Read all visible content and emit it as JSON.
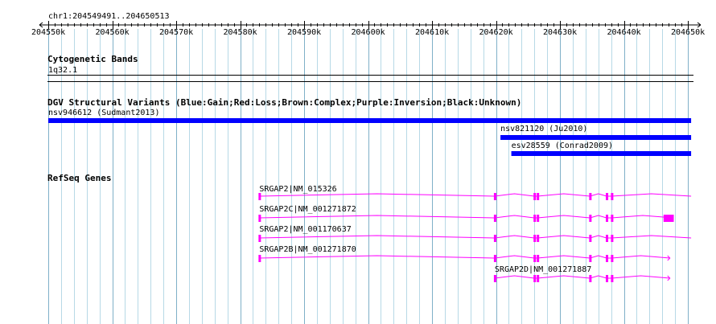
{
  "region": {
    "label": "chr1:204549491..204650513",
    "start": 204549491,
    "end": 204650513
  },
  "ruler": {
    "tick_labels": [
      "204550k",
      "204560k",
      "204570k",
      "204580k",
      "204590k",
      "204600k",
      "204610k",
      "204620k",
      "204630k",
      "204640k",
      "204650k"
    ],
    "tick_values": [
      204550000,
      204560000,
      204570000,
      204580000,
      204590000,
      204600000,
      204610000,
      204620000,
      204630000,
      204640000,
      204650000
    ]
  },
  "tracks": {
    "cytobands": {
      "title": "Cytogenetic Bands",
      "band_label": "1q32.1"
    },
    "dgv": {
      "title": "DGV Structural Variants (Blue:Gain;Red:Loss;Brown:Complex;Purple:Inversion;Black:Unknown)",
      "color": "#0000ff",
      "variants": [
        {
          "label": "nsv946612 (Sudmant2013)",
          "start": 204550000,
          "end": 204650513
        },
        {
          "label": "nsv821120 (Ju2010)",
          "start": 204620700,
          "end": 204650513
        },
        {
          "label": "esv28559 (Conrad2009)",
          "start": 204622400,
          "end": 204650513
        }
      ]
    },
    "refseq": {
      "title": "RefSeq Genes",
      "color": "#ff00ff",
      "genes": [
        {
          "label": "SRGAP2|NM_015326",
          "start": 204583000,
          "end": 204650513,
          "exons": [
            204583000,
            204619800,
            204626000,
            204626500,
            204634700,
            204637300,
            204638100
          ]
        },
        {
          "label": "SRGAP2C|NM_001271872",
          "start": 204583000,
          "end": 204647800,
          "exons": [
            204583000,
            204619800,
            204626000,
            204626500,
            204634700,
            204637300,
            204638100
          ],
          "end_block": [
            204646200,
            204647800
          ]
        },
        {
          "label": "SRGAP2|NM_001170637",
          "start": 204583000,
          "end": 204650513,
          "exons": [
            204583000,
            204619800,
            204626000,
            204626500,
            204634700,
            204637300,
            204638100
          ]
        },
        {
          "label": "SRGAP2B|NM_001271870",
          "start": 204583000,
          "end": 204647200,
          "exons": [
            204583000,
            204619800,
            204626000,
            204626500,
            204634700,
            204637300,
            204638100
          ]
        },
        {
          "label": "SRGAP2D|NM_001271887",
          "start": 204619800,
          "end": 204647200,
          "exons": [
            204619800,
            204626000,
            204626500,
            204634700,
            204637300,
            204638100
          ]
        }
      ]
    }
  }
}
